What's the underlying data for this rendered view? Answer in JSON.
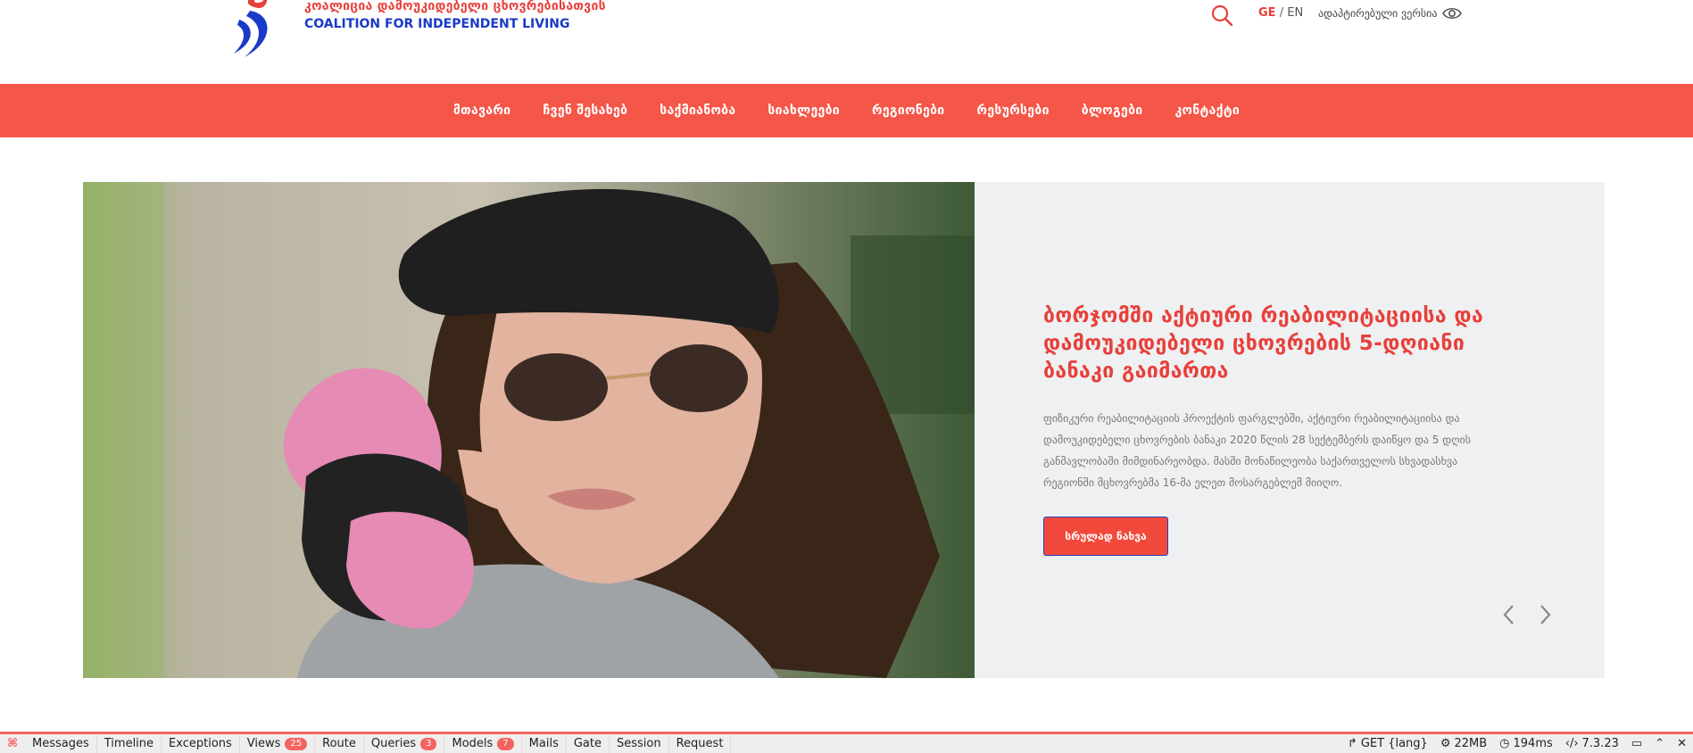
{
  "header": {
    "org_name_ka": "კოალიცია დამოუკიდებელი ცხოვრებისათვის",
    "org_name_en": "COALITION FOR INDEPENDENT LIVING",
    "search_icon": "search-icon",
    "lang_ge": "GE",
    "lang_sep": "/",
    "lang_en": "EN",
    "accessible_label": "ადაპტირებული ვერსია",
    "accessible_icon": "eye-icon",
    "accent_color": "#f45648",
    "brand_blue": "#1a3ac8"
  },
  "nav": {
    "items": [
      {
        "label": "მთავარი"
      },
      {
        "label": "ჩვენ შესახებ"
      },
      {
        "label": "საქმიანობა"
      },
      {
        "label": "სიახლეები"
      },
      {
        "label": "რეგიონები"
      },
      {
        "label": "რესურსები"
      },
      {
        "label": "ბლოგები"
      },
      {
        "label": "კონტაქტი"
      }
    ]
  },
  "hero": {
    "title": "ბორჯომში აქტიური რეაბილიტაციისა და დამოუკიდებელი ცხოვრების 5-დღიანი ბანაკი გაიმართა",
    "description": "ფიზიკური რეაბილიტაციის პროექტის ფარგლებში, აქტიური რეაბილიტაციისა და დამოუკიდებელი ცხოვრების ბანაკი 2020 წლის 28 სექტემბერს დაიწყო და 5 დღის განმავლობაში მიმდინარეობდა. მასში მონაწილეობა საქართველოს სხვადასხვა რეგიონში მცხოვრებმა 16-მა ელეთ მოსარგებლემ მიიღო.",
    "button_label": "სრულად ნახვა",
    "prev_icon": "chevron-left-icon",
    "next_icon": "chevron-right-icon"
  },
  "debugbar": {
    "tabs": [
      {
        "label": "Messages"
      },
      {
        "label": "Timeline"
      },
      {
        "label": "Exceptions"
      },
      {
        "label": "Views",
        "badge": "25"
      },
      {
        "label": "Route"
      },
      {
        "label": "Queries",
        "badge": "3"
      },
      {
        "label": "Models",
        "badge": "7"
      },
      {
        "label": "Mails"
      },
      {
        "label": "Gate"
      },
      {
        "label": "Session"
      },
      {
        "label": "Request"
      }
    ],
    "route": "GET {lang}",
    "memory": "22MB",
    "time": "194ms",
    "php_version": "7.3.23"
  }
}
